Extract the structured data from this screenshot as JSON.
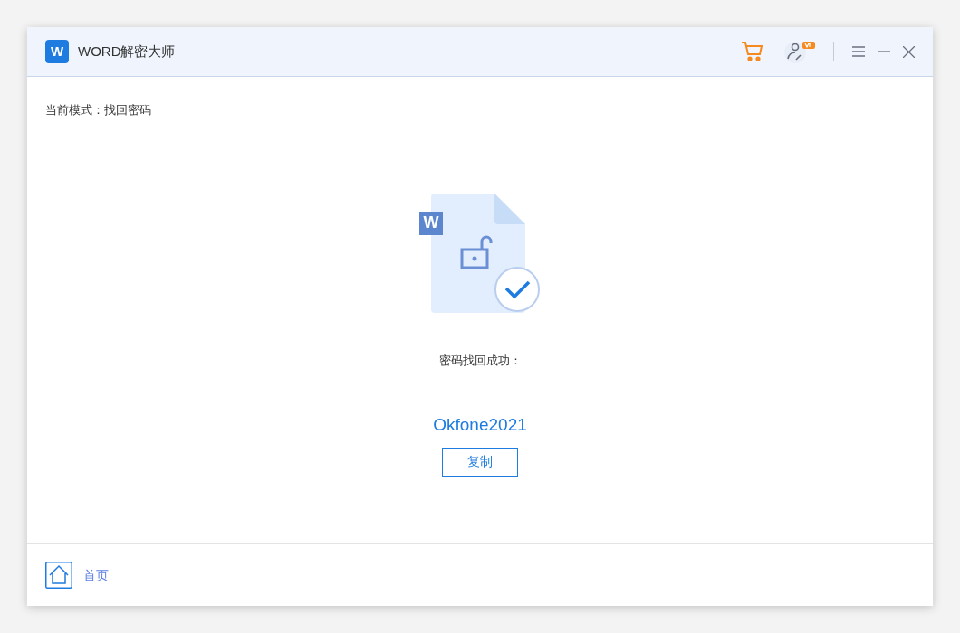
{
  "window": {
    "title": "WORD解密大师",
    "logo_letter": "W"
  },
  "mode_label": "当前模式：找回密码",
  "result": {
    "file_letter": "W",
    "message": "密码找回成功：",
    "password": "Okfone2021",
    "copy_button": "复制"
  },
  "footer": {
    "home_label": "首页"
  }
}
